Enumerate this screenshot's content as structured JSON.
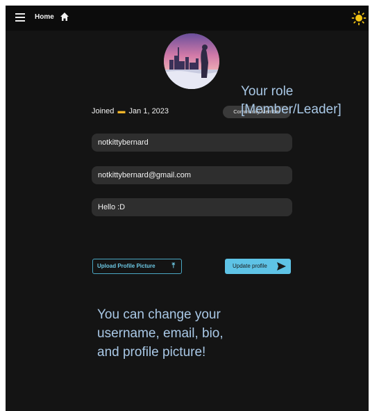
{
  "header": {
    "home_label": "Home",
    "icons": [
      "menu-icon",
      "home-icon",
      "sun-icon"
    ]
  },
  "profile": {
    "joined_label": "Joined",
    "joined_date": "Jan 1, 2023",
    "role": "Community Member",
    "username": "notkittybernard",
    "email": "notkittybernard@gmail.com",
    "bio": "Hello :D"
  },
  "actions": {
    "upload_label": "Upload Profile Picture",
    "update_label": "Update profile"
  },
  "annotations": {
    "role_title": "Your role",
    "role_options": "[Member/Leader]",
    "help_line1": "You can change your",
    "help_line2": "username, email, bio,",
    "help_line3": "and profile picture!"
  },
  "colors": {
    "background": "#141414",
    "field": "#2e2e2e",
    "accent": "#5ec3e6",
    "annotation": "#a9c8e6",
    "sun": "#f6c613"
  }
}
